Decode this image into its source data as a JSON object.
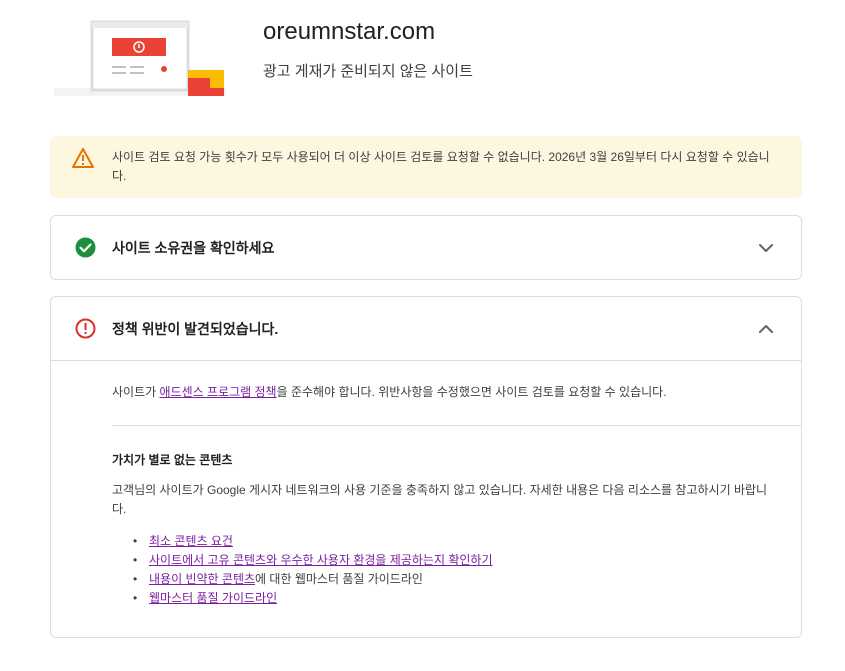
{
  "header": {
    "site_name": "oreumnstar.com",
    "status": "광고 게재가 준비되지 않은 사이트"
  },
  "warning": {
    "text": "사이트 검토 요청 가능 횟수가 모두 사용되어 더 이상 사이트 검토를 요청할 수 없습니다. 2026년 3월 26일부터 다시 요청할 수 있습니다.",
    "icon": "warning-triangle-icon",
    "color": "#e37400"
  },
  "ownership": {
    "title": "사이트 소유권을 확인하세요",
    "icon": "check-circle-icon",
    "color": "#1e8e3e",
    "expanded": false
  },
  "violation": {
    "title": "정책 위반이 발견되었습니다.",
    "icon": "error-circle-icon",
    "color": "#d93025",
    "expanded": true,
    "policy_prefix": "사이트가 ",
    "policy_link": "애드센스 프로그램 정책",
    "policy_suffix": "을 준수해야 합니다. 위반사항을 수정했으면 사이트 검토를 요청할 수 있습니다.",
    "issue_title": "가치가 별로 없는 콘텐츠",
    "issue_desc": "고객님의 사이트가 Google 게시자 네트워크의 사용 기준을 충족하지 않고 있습니다. 자세한 내용은 다음 리소스를 참고하시기 바랍니다.",
    "resources": [
      {
        "link": "최소 콘텐츠 요건",
        "suffix": ""
      },
      {
        "link": "사이트에서 고유 콘텐츠와 우수한 사용자 환경을 제공하는지 확인하기",
        "suffix": ""
      },
      {
        "link": "내용이 빈약한 콘텐츠",
        "suffix": "에 대한 웹마스터 품질 가이드라인"
      },
      {
        "link": "웹마스터 품질 가이드라인",
        "suffix": ""
      }
    ]
  }
}
